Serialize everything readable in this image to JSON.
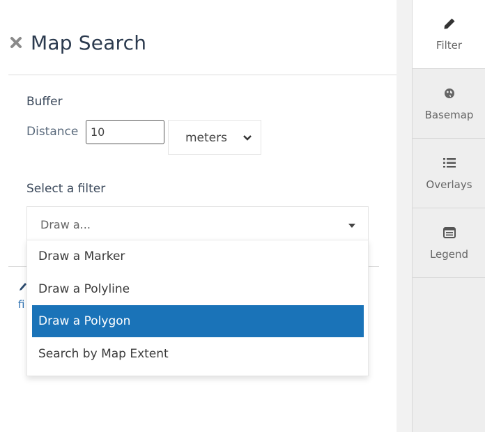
{
  "panel": {
    "title": "Map Search",
    "close_icon": "close-icon"
  },
  "buffer": {
    "section_label": "Buffer",
    "distance_label": "Distance",
    "distance_value": "10",
    "units_value": "meters"
  },
  "filter": {
    "section_label": "Select a filter",
    "placeholder": "Draw a...",
    "options": [
      {
        "label": "Draw a Marker",
        "selected": false
      },
      {
        "label": "Draw a Polyline",
        "selected": false
      },
      {
        "label": "Draw a Polygon",
        "selected": true
      },
      {
        "label": "Search by Map Extent",
        "selected": false
      }
    ],
    "partial_text": "fi"
  },
  "sidebar": {
    "tabs": [
      {
        "label": "Filter",
        "icon": "pencil-icon",
        "active": true
      },
      {
        "label": "Basemap",
        "icon": "globe-icon",
        "active": false
      },
      {
        "label": "Overlays",
        "icon": "list-icon",
        "active": false
      },
      {
        "label": "Legend",
        "icon": "legend-icon",
        "active": false
      }
    ]
  },
  "colors": {
    "accent": "#1a73b8",
    "title": "#2b3a4e",
    "sidebar_bg": "#eeeeee"
  }
}
